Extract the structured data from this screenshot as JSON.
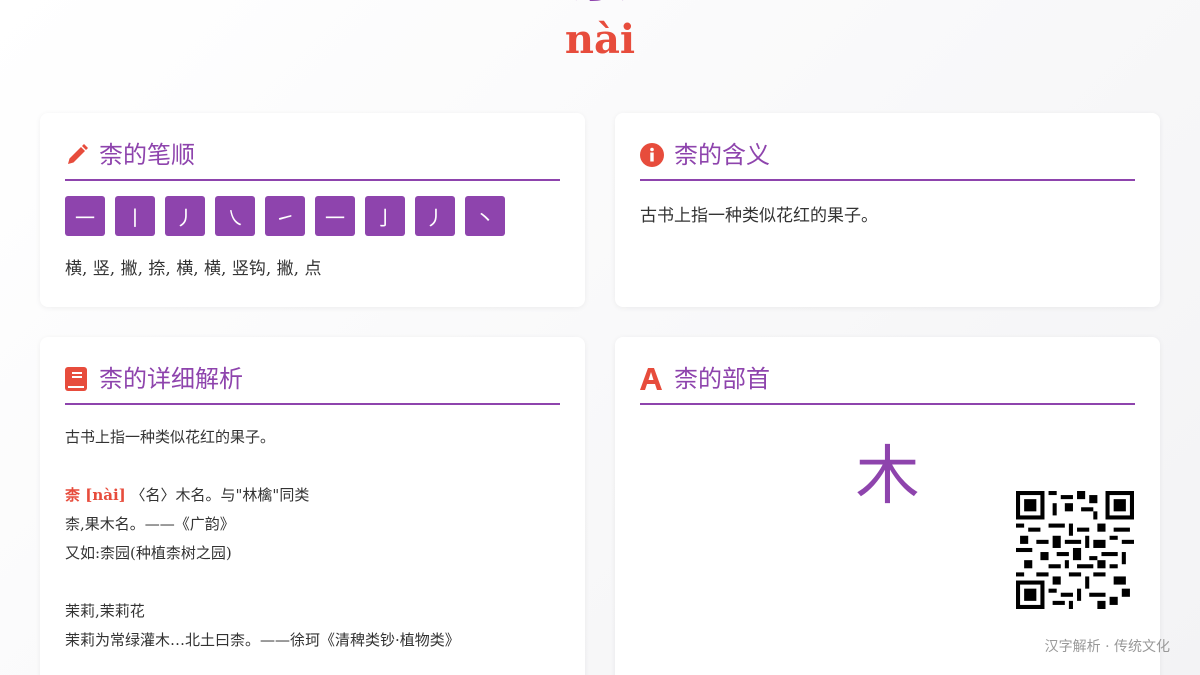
{
  "hero": {
    "character": "柰",
    "pinyin": "nài"
  },
  "stroke_card": {
    "title": "柰的笔顺",
    "icon": "pencil-icon",
    "strokes": [
      "一",
      "丨",
      "丿",
      "㇏",
      "㇀",
      "一",
      "亅",
      "丿",
      "丶"
    ],
    "names": "横, 竖, 撇, 捺, 横, 横, 竖钩, 撇, 点"
  },
  "meaning_card": {
    "title": "柰的含义",
    "icon": "info-icon",
    "text": "古书上指一种类似花红的果子。"
  },
  "detail_card": {
    "title": "柰的详细解析",
    "icon": "book-icon",
    "line1": "古书上指一种类似花红的果子。",
    "entry_head": "柰 [nài]",
    "entry_rest": "〈名〉木名。与\"林檎\"同类",
    "line3": "柰,果木名。——《广韵》",
    "line4": "又如:柰园(种植柰树之园)",
    "line5": "茉莉,茉莉花",
    "line6": "茉莉为常绿灌木…北土曰柰。——徐珂《清稗类钞·植物类》"
  },
  "radical_card": {
    "title": "柰的部首",
    "icon": "font-icon",
    "radical": "木"
  },
  "footer": {
    "text": "汉字解析 · 传统文化"
  },
  "colors": {
    "accent": "#8e44ad",
    "highlight": "#e74c3c"
  }
}
